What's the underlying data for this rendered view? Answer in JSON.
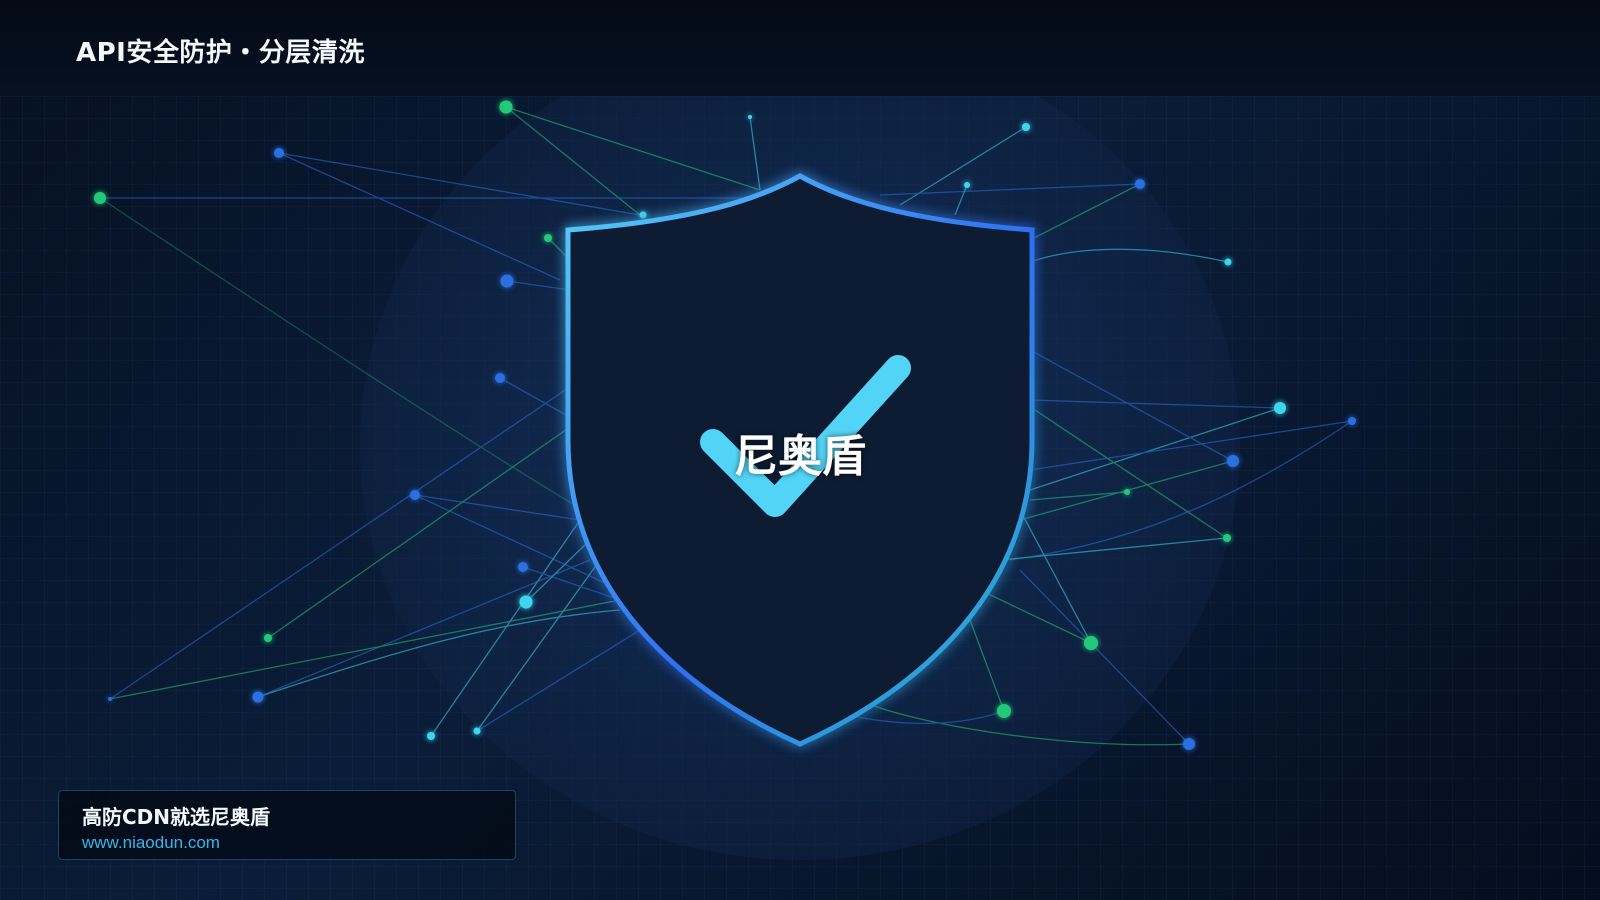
{
  "header": {
    "title": "API安全防护・分层清洗"
  },
  "shield": {
    "label": "尼奥盾",
    "icon": "shield-check-icon",
    "outline_gradient": [
      "#4fc6f7",
      "#2f7cf0",
      "#27b8c8"
    ],
    "check_color": "#52d4f7",
    "fill_color": "#0d1a33"
  },
  "promo": {
    "title": "高防CDN就选尼奥盾",
    "url": "www.niaodun.com"
  },
  "colors": {
    "background": "#071426",
    "node_green": "#22c97a",
    "node_blue": "#2a6fe0",
    "node_cyan": "#3ed6ee",
    "accent_url": "#39b6e8"
  }
}
